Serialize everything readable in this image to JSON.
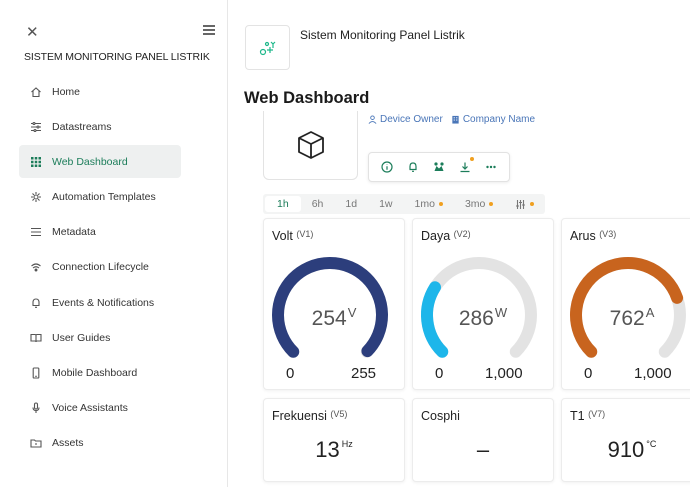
{
  "sidebar": {
    "title": "SISTEM MONITORING PANEL LISTRIK",
    "items": [
      {
        "label": "Home",
        "icon": "home-icon"
      },
      {
        "label": "Datastreams",
        "icon": "datastreams-icon"
      },
      {
        "label": "Web Dashboard",
        "icon": "grid-icon",
        "active": true
      },
      {
        "label": "Automation Templates",
        "icon": "automation-icon"
      },
      {
        "label": "Metadata",
        "icon": "list-icon"
      },
      {
        "label": "Connection Lifecycle",
        "icon": "wifi-icon"
      },
      {
        "label": "Events & Notifications",
        "icon": "bell-icon"
      },
      {
        "label": "User Guides",
        "icon": "book-icon"
      },
      {
        "label": "Mobile Dashboard",
        "icon": "phone-icon"
      },
      {
        "label": "Voice Assistants",
        "icon": "microphone-icon"
      },
      {
        "label": "Assets",
        "icon": "folder-icon"
      }
    ]
  },
  "header": {
    "template_name": "Sistem Monitoring Panel Listrik",
    "page_title": "Web Dashboard"
  },
  "device": {
    "owner_label": "Device Owner",
    "company_label": "Company Name"
  },
  "time_tabs": [
    "1h",
    "6h",
    "1d",
    "1w",
    "1mo",
    "3mo"
  ],
  "accent": "#1c7d5a",
  "widgets": {
    "volt": {
      "title": "Volt",
      "pin": "(V1)",
      "value": "254",
      "unit": "V",
      "min": "0",
      "max": "255",
      "fraction": 0.996,
      "color": "#2c3e7c"
    },
    "daya": {
      "title": "Daya",
      "pin": "(V2)",
      "value": "286",
      "unit": "W",
      "min": "0",
      "max": "1,000",
      "fraction": 0.286,
      "color": "#1db6ea"
    },
    "arus": {
      "title": "Arus",
      "pin": "(V3)",
      "value": "762",
      "unit": "A",
      "min": "0",
      "max": "1,000",
      "fraction": 0.762,
      "color": "#c8641e"
    },
    "frekuensi": {
      "title": "Frekuensi",
      "pin": "(V5)",
      "value": "13",
      "unit": "Hz"
    },
    "cosphi": {
      "title": "Cosphi",
      "value": "–"
    },
    "t1": {
      "title": "T1",
      "pin": "(V7)",
      "value": "910",
      "unit": "°C"
    }
  }
}
